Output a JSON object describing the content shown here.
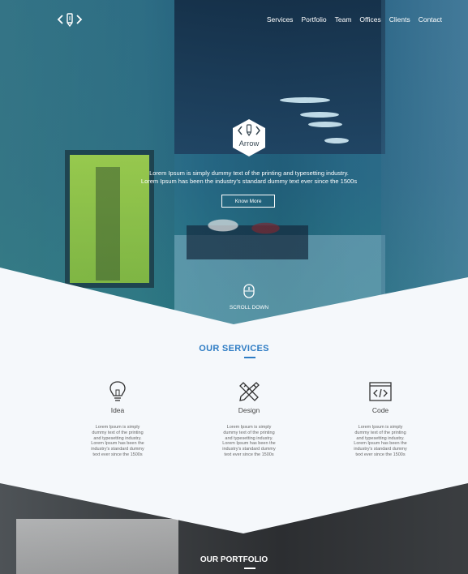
{
  "nav": {
    "logo_icon": "arrow-pencil-logo-icon",
    "items": [
      "Services",
      "Portfolio",
      "Team",
      "Offices",
      "Clients",
      "Contact"
    ]
  },
  "hero": {
    "brand": "Arrow",
    "line1": "Lorem Ipsum is simply dummy text of the printing and typesetting industry.",
    "line2": "Lorem Ipsum has been the industry's standard dummy text ever since the 1500s",
    "button": "Know More",
    "scroll": "SCROLL DOWN"
  },
  "services": {
    "title": "OUR SERVICES",
    "accent": "#2e7cc4",
    "items": [
      {
        "icon": "lightbulb-icon",
        "name": "Idea",
        "desc": "Lorem Ipsum is simply dummy text of the printing and typesetting industry. Lorem Ipsum has been the industry's standard dummy text ever since the 1500s"
      },
      {
        "icon": "pencil-ruler-icon",
        "name": "Design",
        "desc": "Lorem Ipsum is simply dummy text of the printing and typesetting industry. Lorem Ipsum has been the industry's standard dummy text ever since the 1500s"
      },
      {
        "icon": "code-window-icon",
        "name": "Code",
        "desc": "Lorem Ipsum is simply dummy text of the printing and typesetting industry. Lorem Ipsum has been the industry's standard dummy text ever since the 1500s"
      }
    ]
  },
  "portfolio": {
    "title": "OUR PORTFOLIO"
  }
}
